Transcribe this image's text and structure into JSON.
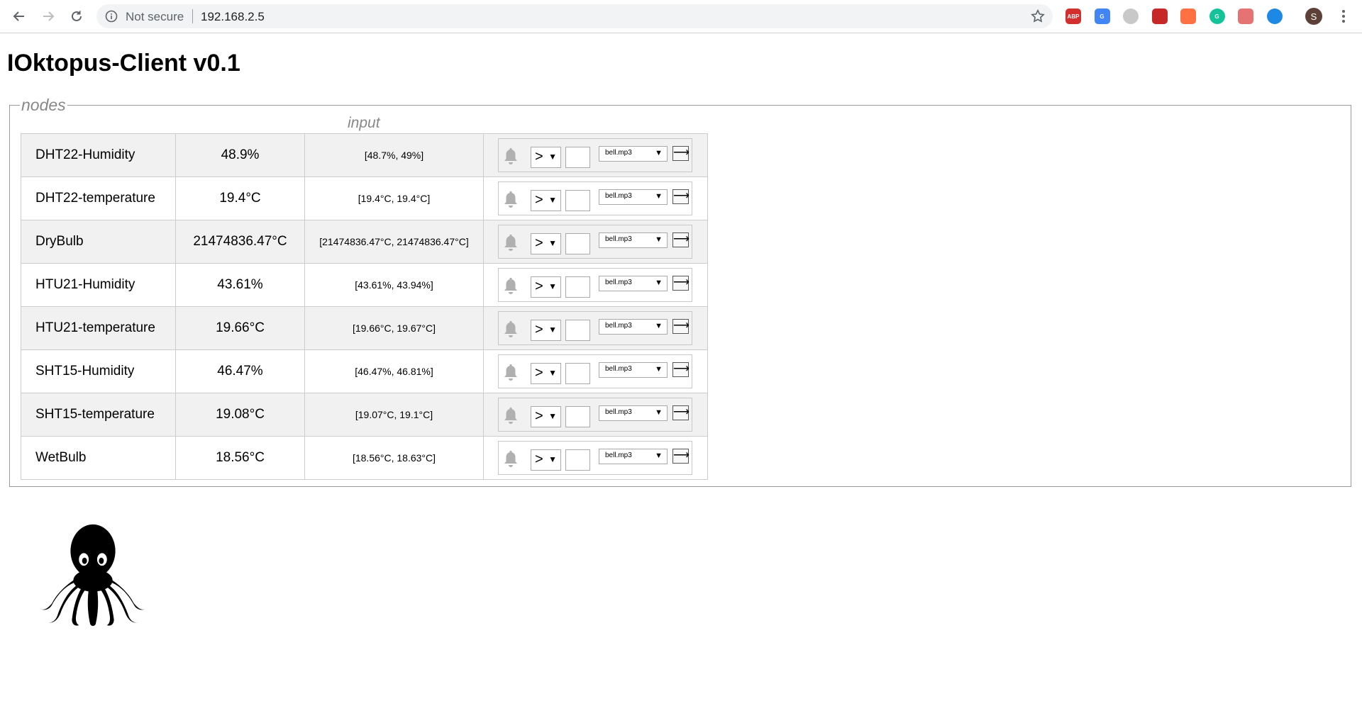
{
  "browser": {
    "not_secure_label": "Not secure",
    "url": "192.168.2.5",
    "avatar_letter": "S",
    "extensions": [
      {
        "icon": "adblock-plus-icon",
        "label": "ABP",
        "color": "#d32f2f"
      },
      {
        "icon": "google-translate-icon",
        "label": "G",
        "color": "#4285f4"
      },
      {
        "icon": "globe-icon",
        "label": "",
        "color": "#c8c8c8"
      },
      {
        "icon": "video-ext-icon",
        "label": "",
        "color": "#c62828"
      },
      {
        "icon": "squirrel-ext-icon",
        "label": "",
        "color": "#ff7043"
      },
      {
        "icon": "grammarly-icon",
        "label": "G",
        "color": "#15c39a"
      },
      {
        "icon": "eye-ext-icon",
        "label": "",
        "color": "#e57373"
      },
      {
        "icon": "vpn-ext-icon",
        "label": "",
        "color": "#1e88e5"
      }
    ]
  },
  "page": {
    "title": "IOktopus-Client v0.1",
    "fieldset_legend": "nodes",
    "input_header": "input"
  },
  "sensors": [
    {
      "name": "DHT22-Humidity",
      "value": "48.9%",
      "range": "[48.7%, 49%]",
      "operator": ">",
      "sound": "bell.mp3"
    },
    {
      "name": "DHT22-temperature",
      "value": "19.4°C",
      "range": "[19.4°C, 19.4°C]",
      "operator": ">",
      "sound": "bell.mp3"
    },
    {
      "name": "DryBulb",
      "value": "21474836.47°C",
      "range": "[21474836.47°C, 21474836.47°C]",
      "operator": ">",
      "sound": "bell.mp3"
    },
    {
      "name": "HTU21-Humidity",
      "value": "43.61%",
      "range": "[43.61%, 43.94%]",
      "operator": ">",
      "sound": "bell.mp3"
    },
    {
      "name": "HTU21-temperature",
      "value": "19.66°C",
      "range": "[19.66°C, 19.67°C]",
      "operator": ">",
      "sound": "bell.mp3"
    },
    {
      "name": "SHT15-Humidity",
      "value": "46.47%",
      "range": "[46.47%, 46.81%]",
      "operator": ">",
      "sound": "bell.mp3"
    },
    {
      "name": "SHT15-temperature",
      "value": "19.08°C",
      "range": "[19.07°C, 19.1°C]",
      "operator": ">",
      "sound": "bell.mp3"
    },
    {
      "name": "WetBulb",
      "value": "18.56°C",
      "range": "[18.56°C, 18.63°C]",
      "operator": ">",
      "sound": "bell.mp3"
    }
  ],
  "controls": {
    "go_button_glyph": "⟶",
    "select_arrow": "▼"
  }
}
